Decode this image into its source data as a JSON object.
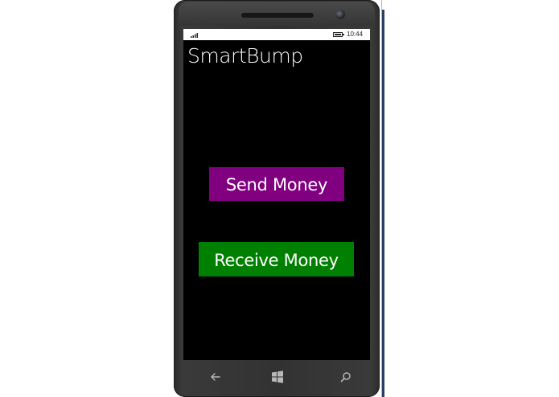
{
  "device": {
    "status_bar": {
      "time": "10:44",
      "signal_icon": "signal-icon",
      "battery_icon": "battery-icon"
    },
    "nav_bar": {
      "back_icon": "back-arrow-icon",
      "start_icon": "windows-logo-icon",
      "search_icon": "search-icon"
    }
  },
  "app": {
    "title": "SmartBump",
    "buttons": {
      "send_label": "Send Money",
      "receive_label": "Receive Money"
    }
  },
  "colors": {
    "send_button": "#800080",
    "receive_button": "#008000",
    "screen_background": "#000000",
    "title_text": "#ffffff"
  }
}
